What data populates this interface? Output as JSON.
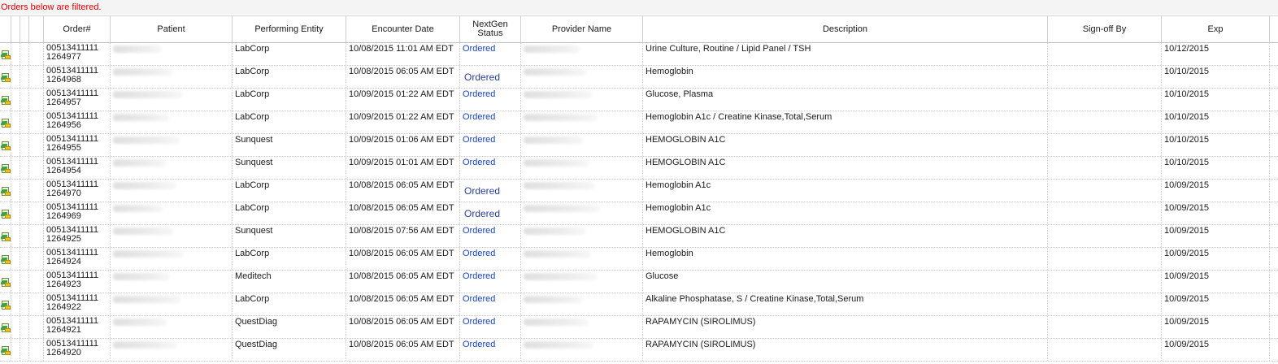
{
  "banner": "Orders below are filtered.",
  "columns": [
    "",
    "",
    "",
    "",
    "Order#",
    "Patient",
    "Performing Entity",
    "Encounter Date",
    "NextGen\nStatus",
    "Provider Name",
    "Description",
    "Sign-off By",
    "Exp"
  ],
  "rows": [
    {
      "order": "00513411111",
      "order_sub": "1264977",
      "entity": "LabCorp",
      "date": "10/08/2015 11:01 AM EDT",
      "status": "Ordered",
      "description": "Urine Culture, Routine / Lipid Panel / TSH",
      "exp": "10/12/2015"
    },
    {
      "order": "00513411111",
      "order_sub": "1264968",
      "entity": "LabCorp",
      "date": "10/08/2015 06:05 AM EDT",
      "status": "Ordered",
      "description": "Hemoglobin",
      "exp": "10/10/2015"
    },
    {
      "order": "00513411111",
      "order_sub": "1264957",
      "entity": "LabCorp",
      "date": "10/09/2015 01:22 AM EDT",
      "status": "Ordered",
      "description": "Glucose, Plasma",
      "exp": "10/10/2015"
    },
    {
      "order": "00513411111",
      "order_sub": "1264956",
      "entity": "LabCorp",
      "date": "10/09/2015 01:22 AM EDT",
      "status": "Ordered",
      "description": "Hemoglobin A1c / Creatine Kinase,Total,Serum",
      "exp": "10/10/2015"
    },
    {
      "order": "00513411111",
      "order_sub": "1264955",
      "entity": "Sunquest",
      "date": "10/09/2015 01:06 AM EDT",
      "status": "Ordered",
      "description": "HEMOGLOBIN A1C",
      "exp": "10/10/2015"
    },
    {
      "order": "00513411111",
      "order_sub": "1264954",
      "entity": "Sunquest",
      "date": "10/09/2015 01:01 AM EDT",
      "status": "Ordered",
      "description": "HEMOGLOBIN A1C",
      "exp": "10/10/2015"
    },
    {
      "order": "00513411111",
      "order_sub": "1264970",
      "entity": "LabCorp",
      "date": "10/08/2015 06:05 AM EDT",
      "status": "Ordered",
      "description": "Hemoglobin A1c",
      "exp": "10/09/2015"
    },
    {
      "order": "00513411111",
      "order_sub": "1264969",
      "entity": "LabCorp",
      "date": "10/08/2015 06:05 AM EDT",
      "status": "Ordered",
      "description": "Hemoglobin A1c",
      "exp": "10/09/2015"
    },
    {
      "order": "00513411111",
      "order_sub": "1264925",
      "entity": "Sunquest",
      "date": "10/08/2015 07:56 AM EDT",
      "status": "Ordered",
      "description": "HEMOGLOBIN A1C",
      "exp": "10/09/2015"
    },
    {
      "order": "00513411111",
      "order_sub": "1264924",
      "entity": "LabCorp",
      "date": "10/08/2015 06:05 AM EDT",
      "status": "Ordered",
      "description": "Hemoglobin",
      "exp": "10/09/2015"
    },
    {
      "order": "00513411111",
      "order_sub": "1264923",
      "entity": "Meditech",
      "date": "10/08/2015 06:05 AM EDT",
      "status": "Ordered",
      "description": "Glucose",
      "exp": "10/09/2015"
    },
    {
      "order": "00513411111",
      "order_sub": "1264922",
      "entity": "LabCorp",
      "date": "10/08/2015 06:05 AM EDT",
      "status": "Ordered",
      "description": "Alkaline Phosphatase, S / Creatine Kinase,Total,Serum",
      "exp": "10/09/2015"
    },
    {
      "order": "00513411111",
      "order_sub": "1264921",
      "entity": "QuestDiag",
      "date": "10/08/2015 06:05 AM EDT",
      "status": "Ordered",
      "description": "RAPAMYCIN (SIROLIMUS)",
      "exp": "10/09/2015"
    },
    {
      "order": "00513411111",
      "order_sub": "1264920",
      "entity": "QuestDiag",
      "date": "10/08/2015 06:05 AM EDT",
      "status": "Ordered",
      "description": "RAPAMYCIN (SIROLIMUS)",
      "exp": "10/09/2015"
    }
  ],
  "alt_status_rows": [
    1,
    6,
    7
  ],
  "colors": {
    "banner_text": "#e00000",
    "status_link": "#1844c8",
    "icon_leaf": "#3da33d",
    "icon_flag": "#e8c21e"
  },
  "icons": {
    "row_icon": "lab-order-document-icon"
  }
}
